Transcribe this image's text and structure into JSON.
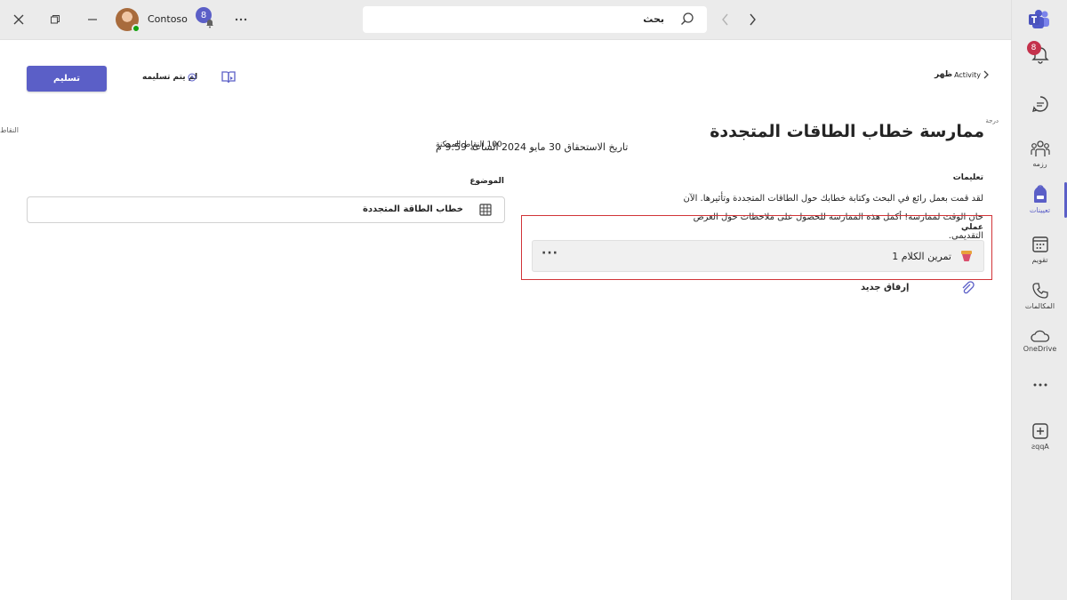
{
  "titlebar": {
    "org_name": "Contoso",
    "notification_count": "8",
    "search_text": "بحث",
    "close_icon": "close-icon",
    "restore_icon": "restore-icon",
    "minimize_icon": "minimize-icon",
    "more_icon": "more-icon"
  },
  "rail": {
    "activity_badge": "8",
    "items": [
      {
        "icon": "bell-icon",
        "label": ""
      },
      {
        "icon": "chat-icon",
        "label": ""
      },
      {
        "icon": "people-icon",
        "label": "رزمه"
      },
      {
        "icon": "backpack-icon",
        "label": "تعيينات"
      },
      {
        "icon": "calendar-icon",
        "label": "تقويم"
      },
      {
        "icon": "phone-icon",
        "label": "المكالمات"
      },
      {
        "icon": "onedrive-icon",
        "label": "OneDrive"
      },
      {
        "icon": "more-horizontal-icon",
        "label": ""
      },
      {
        "icon": "add-apps-icon",
        "label": "Apps"
      }
    ]
  },
  "header": {
    "submit_label": "تسليم",
    "status_text": "لم يتم تسليمه",
    "back_label": "ظهر",
    "activity_tag": "Activity",
    "grade_tag": "درجة",
    "points_label": "النقاط"
  },
  "assignment": {
    "title": "ممارسة خطاب الطاقات المتجددة",
    "due_text": "تاريخ الاستحقاق 30 مايو 2024 الساعة 9:59 م",
    "points_possible": "100 النقاط الممكنة",
    "instructions_label": "تعليمات",
    "instructions_text": "لقد قمت بعمل رائع في البحث وكتابة خطابك حول الطاقات المتجددة وتأثيرها. الآن حان الوقت لممارسة! أكمل هذه الممارسة للحصول على ملاحظات حول العرض التقديمي.",
    "topic_label": "الموضوع",
    "topic_value": "خطاب الطاقة المتجددة",
    "work_label": "عملي",
    "work_file": "تمرين الكلام 1",
    "attach_new": "إرفاق جديد"
  },
  "colors": {
    "accent": "#5b5fc7",
    "alert_badge": "#c4314b",
    "highlight_border": "#d13438"
  }
}
